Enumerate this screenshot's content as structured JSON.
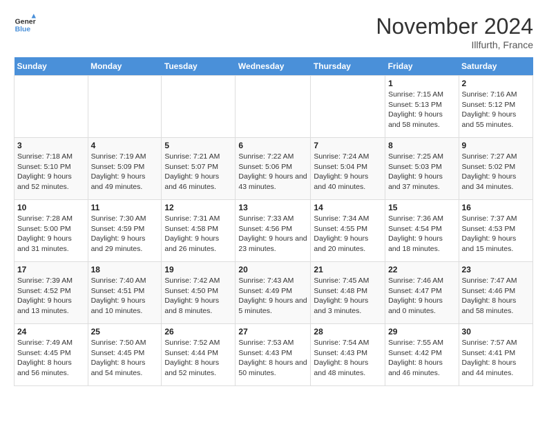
{
  "logo": {
    "line1": "General",
    "line2": "Blue"
  },
  "title": "November 2024",
  "location": "Illfurth, France",
  "days_of_week": [
    "Sunday",
    "Monday",
    "Tuesday",
    "Wednesday",
    "Thursday",
    "Friday",
    "Saturday"
  ],
  "weeks": [
    [
      {
        "day": "",
        "info": ""
      },
      {
        "day": "",
        "info": ""
      },
      {
        "day": "",
        "info": ""
      },
      {
        "day": "",
        "info": ""
      },
      {
        "day": "",
        "info": ""
      },
      {
        "day": "1",
        "info": "Sunrise: 7:15 AM\nSunset: 5:13 PM\nDaylight: 9 hours and 58 minutes."
      },
      {
        "day": "2",
        "info": "Sunrise: 7:16 AM\nSunset: 5:12 PM\nDaylight: 9 hours and 55 minutes."
      }
    ],
    [
      {
        "day": "3",
        "info": "Sunrise: 7:18 AM\nSunset: 5:10 PM\nDaylight: 9 hours and 52 minutes."
      },
      {
        "day": "4",
        "info": "Sunrise: 7:19 AM\nSunset: 5:09 PM\nDaylight: 9 hours and 49 minutes."
      },
      {
        "day": "5",
        "info": "Sunrise: 7:21 AM\nSunset: 5:07 PM\nDaylight: 9 hours and 46 minutes."
      },
      {
        "day": "6",
        "info": "Sunrise: 7:22 AM\nSunset: 5:06 PM\nDaylight: 9 hours and 43 minutes."
      },
      {
        "day": "7",
        "info": "Sunrise: 7:24 AM\nSunset: 5:04 PM\nDaylight: 9 hours and 40 minutes."
      },
      {
        "day": "8",
        "info": "Sunrise: 7:25 AM\nSunset: 5:03 PM\nDaylight: 9 hours and 37 minutes."
      },
      {
        "day": "9",
        "info": "Sunrise: 7:27 AM\nSunset: 5:02 PM\nDaylight: 9 hours and 34 minutes."
      }
    ],
    [
      {
        "day": "10",
        "info": "Sunrise: 7:28 AM\nSunset: 5:00 PM\nDaylight: 9 hours and 31 minutes."
      },
      {
        "day": "11",
        "info": "Sunrise: 7:30 AM\nSunset: 4:59 PM\nDaylight: 9 hours and 29 minutes."
      },
      {
        "day": "12",
        "info": "Sunrise: 7:31 AM\nSunset: 4:58 PM\nDaylight: 9 hours and 26 minutes."
      },
      {
        "day": "13",
        "info": "Sunrise: 7:33 AM\nSunset: 4:56 PM\nDaylight: 9 hours and 23 minutes."
      },
      {
        "day": "14",
        "info": "Sunrise: 7:34 AM\nSunset: 4:55 PM\nDaylight: 9 hours and 20 minutes."
      },
      {
        "day": "15",
        "info": "Sunrise: 7:36 AM\nSunset: 4:54 PM\nDaylight: 9 hours and 18 minutes."
      },
      {
        "day": "16",
        "info": "Sunrise: 7:37 AM\nSunset: 4:53 PM\nDaylight: 9 hours and 15 minutes."
      }
    ],
    [
      {
        "day": "17",
        "info": "Sunrise: 7:39 AM\nSunset: 4:52 PM\nDaylight: 9 hours and 13 minutes."
      },
      {
        "day": "18",
        "info": "Sunrise: 7:40 AM\nSunset: 4:51 PM\nDaylight: 9 hours and 10 minutes."
      },
      {
        "day": "19",
        "info": "Sunrise: 7:42 AM\nSunset: 4:50 PM\nDaylight: 9 hours and 8 minutes."
      },
      {
        "day": "20",
        "info": "Sunrise: 7:43 AM\nSunset: 4:49 PM\nDaylight: 9 hours and 5 minutes."
      },
      {
        "day": "21",
        "info": "Sunrise: 7:45 AM\nSunset: 4:48 PM\nDaylight: 9 hours and 3 minutes."
      },
      {
        "day": "22",
        "info": "Sunrise: 7:46 AM\nSunset: 4:47 PM\nDaylight: 9 hours and 0 minutes."
      },
      {
        "day": "23",
        "info": "Sunrise: 7:47 AM\nSunset: 4:46 PM\nDaylight: 8 hours and 58 minutes."
      }
    ],
    [
      {
        "day": "24",
        "info": "Sunrise: 7:49 AM\nSunset: 4:45 PM\nDaylight: 8 hours and 56 minutes."
      },
      {
        "day": "25",
        "info": "Sunrise: 7:50 AM\nSunset: 4:45 PM\nDaylight: 8 hours and 54 minutes."
      },
      {
        "day": "26",
        "info": "Sunrise: 7:52 AM\nSunset: 4:44 PM\nDaylight: 8 hours and 52 minutes."
      },
      {
        "day": "27",
        "info": "Sunrise: 7:53 AM\nSunset: 4:43 PM\nDaylight: 8 hours and 50 minutes."
      },
      {
        "day": "28",
        "info": "Sunrise: 7:54 AM\nSunset: 4:43 PM\nDaylight: 8 hours and 48 minutes."
      },
      {
        "day": "29",
        "info": "Sunrise: 7:55 AM\nSunset: 4:42 PM\nDaylight: 8 hours and 46 minutes."
      },
      {
        "day": "30",
        "info": "Sunrise: 7:57 AM\nSunset: 4:41 PM\nDaylight: 8 hours and 44 minutes."
      }
    ]
  ]
}
